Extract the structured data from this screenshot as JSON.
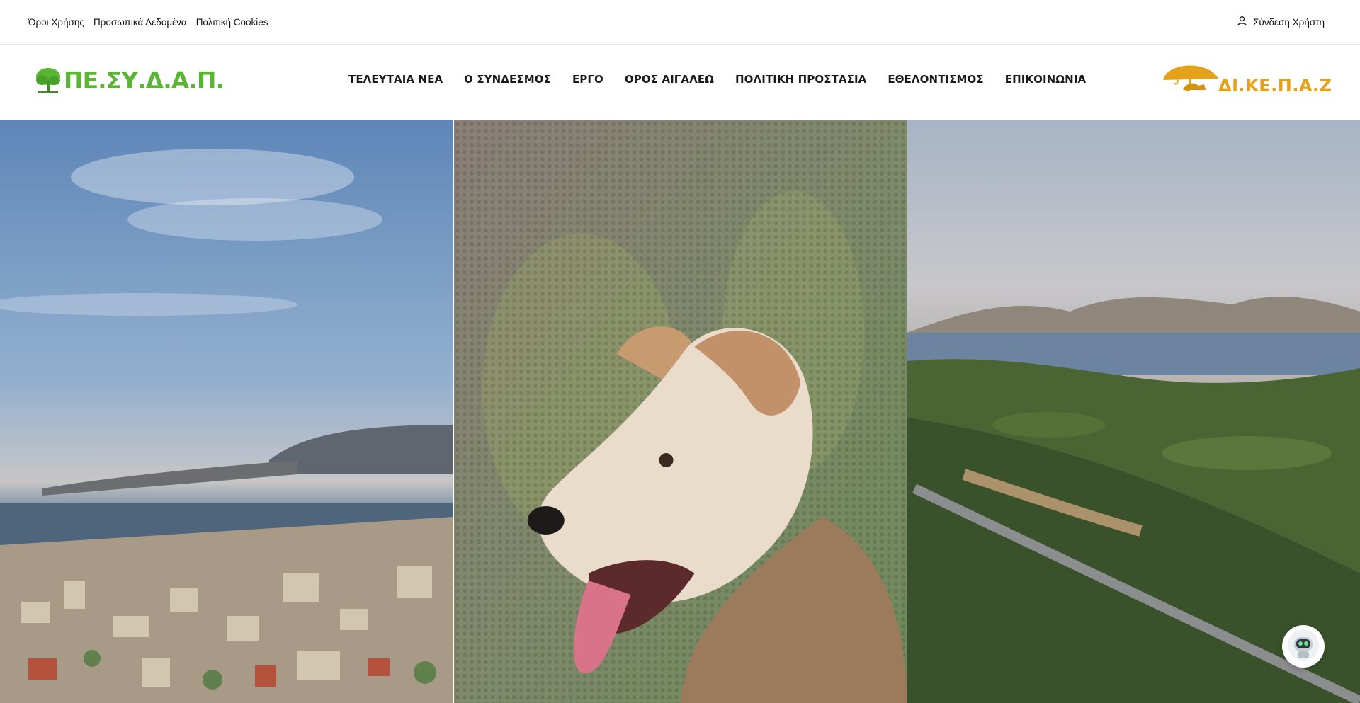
{
  "topbar": {
    "links": [
      "Όροι Χρήσης",
      "Προσωπικά Δεδομένα",
      "Πολιτική Cookies"
    ],
    "login_label": "Σύνδεση Χρήστη"
  },
  "header": {
    "logo_left_text": "ΠΕ.ΣΥ.Δ.Α.Π.",
    "logo_right_text": "ΔΙ.ΚΕ.Π.Α.Ζ",
    "nav": [
      "ΤΕΛΕΥΤΑΙΑ ΝΕΑ",
      "Ο ΣΥΝΔΕΣΜΟΣ",
      "ΕΡΓΟ",
      "ΟΡΟΣ ΑΙΓΑΛΕΩ",
      "ΠΟΛΙΤΙΚΗ ΠΡΟΣΤΑΣΙΑ",
      "ΕΘΕΛΟΝΤΙΣΜΟΣ",
      "ΕΠΙΚΟΙΝΩΝΙΑ"
    ]
  },
  "hero": {
    "panels": [
      "city-harbor-photo",
      "dog-portrait-photo",
      "mountain-landscape-photo"
    ]
  },
  "colors": {
    "brand_green": "#5bb535",
    "brand_orange": "#e3a21a",
    "nav_text": "#1a1a1a"
  },
  "icons": {
    "login": "user-icon",
    "chatbot": "robot-icon"
  }
}
